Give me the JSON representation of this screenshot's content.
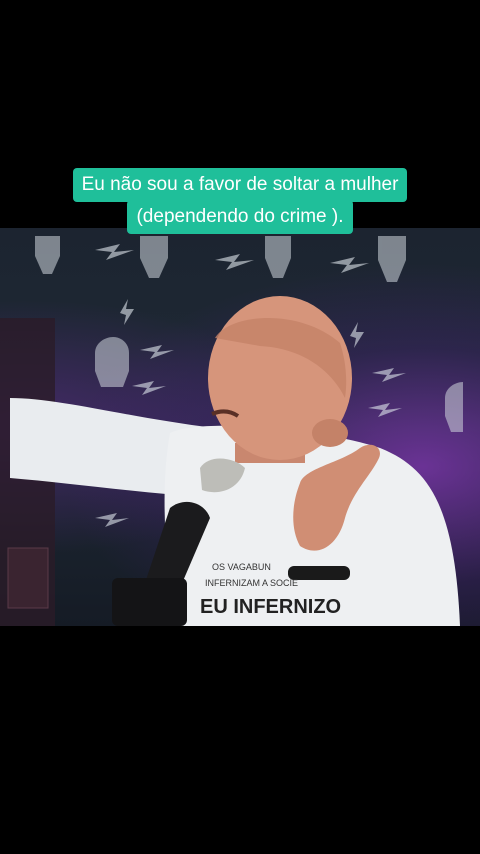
{
  "caption": {
    "line1": "Eu não sou a favor de soltar a mulher",
    "line2": "(dependendo do crime )."
  },
  "shirt": {
    "line1": "OS VAGABUN",
    "line2": "INFERNIZAM A SOCIE",
    "line3": "EU INFERNIZO"
  },
  "colors": {
    "caption_bg": "#1fbf9a",
    "background": "#000000",
    "glow": "#a03ce6"
  }
}
